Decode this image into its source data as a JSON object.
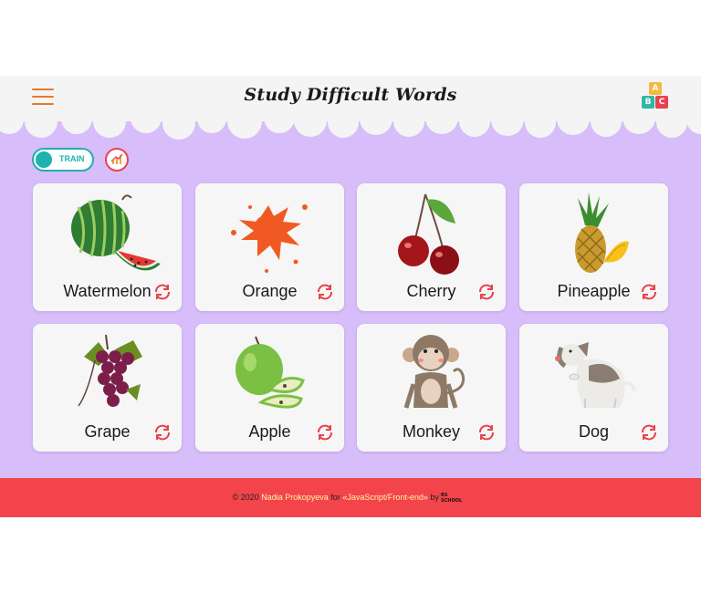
{
  "header": {
    "title": "Study Difficult Words",
    "logo_letters": [
      "A",
      "B",
      "C"
    ],
    "logo_colors": [
      "#f5b942",
      "#2eb8a8",
      "#e8434c"
    ]
  },
  "controls": {
    "mode_label": "TRAIN",
    "accent": "#1fb0b0",
    "stats_icon": "chart-icon"
  },
  "cards": [
    {
      "word": "Watermelon",
      "icon": "watermelon-icon"
    },
    {
      "word": "Orange",
      "icon": "orange-splash-icon"
    },
    {
      "word": "Cherry",
      "icon": "cherry-icon"
    },
    {
      "word": "Pineapple",
      "icon": "pineapple-icon"
    },
    {
      "word": "Grape",
      "icon": "grape-icon"
    },
    {
      "word": "Apple",
      "icon": "apple-icon"
    },
    {
      "word": "Monkey",
      "icon": "monkey-icon"
    },
    {
      "word": "Dog",
      "icon": "dog-icon"
    }
  ],
  "footer": {
    "copyright": "© 2020",
    "author": "Nadia Prokopyeva",
    "for_text": "for",
    "course": "«JavaScript/Front-end»",
    "by_text": "by",
    "school_logo_text": "RS SCHOOL"
  },
  "colors": {
    "background": "#d7bdfa",
    "header": "#f4f4f4",
    "footer": "#f4444b",
    "menu": "#e47a2e",
    "flip": "#e8434c"
  }
}
